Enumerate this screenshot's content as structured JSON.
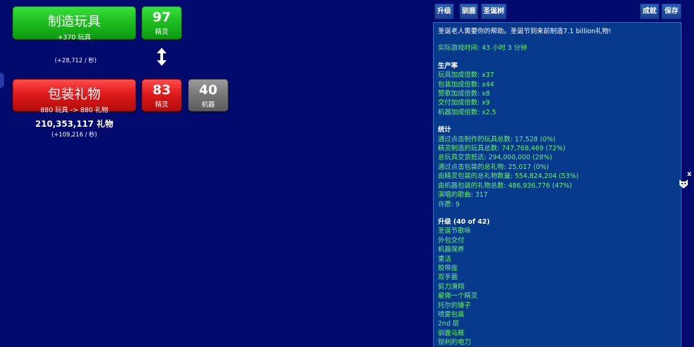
{
  "make": {
    "title": "制造玩具",
    "subtitle": "+370 玩具",
    "elves_count": "97",
    "elves_label": "精灵",
    "rate": "(+28,712 / 秒)"
  },
  "wrap": {
    "title": "包装礼物",
    "subtitle": "880 玩具 -> 880 礼物",
    "elves_count": "83",
    "elves_label": "精灵",
    "machines_count": "40",
    "machines_label": "机器",
    "total": "210,353,117 礼物",
    "rate": "(+109,216 / 秒)"
  },
  "tabs": {
    "upgrades": "升级",
    "reindeer": "驯鹿",
    "tree": "圣诞树",
    "achievements": "成就",
    "save": "保存"
  },
  "info": {
    "intro": "圣诞老人需要你的帮助。圣诞节到来前制造7.1 billion礼物!",
    "play_time": "实际游戏时间:  43 小时 3 分钟",
    "production_heading": "生产率",
    "production": [
      "玩具加成倍数: x37",
      "包装加成倍数: x44",
      "赞歌加成倍数: x8",
      "交付加成倍数: x9",
      "机器加成倍数: x2.5"
    ],
    "stats_heading": "统计",
    "stats": [
      "通过点击制作的玩具总数:  17,528 (0%)",
      "精灵制造的玩具总数: 747,768,469 (72%)",
      "总玩具交货抵达: 294,000,000 (28%)",
      "通过点击包装的总礼物:  25,017 (0%)",
      "由精灵包装的总礼物数量: 554,824,204 (53%)",
      "由机器包装的礼物总数: 486,936,776 (47%)",
      "演唱的歌曲: 317",
      "许愿: 9"
    ],
    "upgrades_heading": "升级 (40 of 42)",
    "upgrades": [
      "圣诞节歌咏",
      "外包交付",
      "机器保养",
      "重活",
      "胶带座",
      "双手菌",
      "剪刀滑翔",
      "雇佣一个精灵",
      "托尔的锤子",
      "喷雾包装",
      "2nd 层",
      "驯鹿马厩",
      "锐利的电刀"
    ]
  },
  "overlay": {
    "close": "x"
  }
}
